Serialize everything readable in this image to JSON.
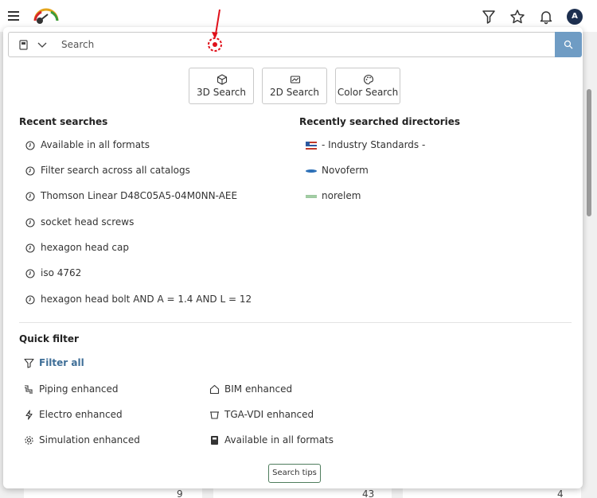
{
  "colors": {
    "accent_blue": "#6f9cc4",
    "link_blue": "#3e6e97",
    "tips_border": "#4f7d5d",
    "cursor_red": "#e0101a",
    "avatar_bg": "#1d2f4f"
  },
  "topbar": {
    "menu_icon": "hamburger-icon",
    "logo_icon": "gauge-logo-icon",
    "filter_icon": "funnel-icon",
    "favorites_icon": "star-icon",
    "notifications_icon": "bell-icon",
    "avatar_initial": "A"
  },
  "search": {
    "placeholder": "Search",
    "value": "",
    "category_icon": "catalog-icon",
    "dropdown_icon": "chevron-down-icon",
    "submit_icon": "search-icon"
  },
  "modes": [
    {
      "label": "3D Search",
      "icon": "cube-icon"
    },
    {
      "label": "2D Search",
      "icon": "drawing-icon"
    },
    {
      "label": "Color Search",
      "icon": "palette-icon"
    }
  ],
  "recent_searches": {
    "title": "Recent searches",
    "items": [
      "Available in all formats",
      "Filter search across all catalogs",
      "Thomson Linear D48C05A5-04M0NN-AEE",
      "socket head screws",
      "hexagon head cap",
      "iso 4762",
      "hexagon head bolt AND A = 1.4 AND L = 12"
    ]
  },
  "recent_directories": {
    "title": "Recently searched directories",
    "items": [
      {
        "label": "- Industry Standards -",
        "icon": "flag-grid-icon"
      },
      {
        "label": "Novoferm",
        "icon": "novoferm-logo-icon"
      },
      {
        "label": "norelem",
        "icon": "norelem-logo-icon"
      }
    ]
  },
  "quick_filter": {
    "title": "Quick filter",
    "filter_all": "Filter all",
    "items": [
      {
        "label": "Piping enhanced",
        "icon": "piping-icon"
      },
      {
        "label": "BIM enhanced",
        "icon": "house-icon"
      },
      {
        "label": "Electro enhanced",
        "icon": "lightning-icon"
      },
      {
        "label": "TGA-VDI enhanced",
        "icon": "hvac-icon"
      },
      {
        "label": "Simulation enhanced",
        "icon": "gear-icon"
      },
      {
        "label": "Available in all formats",
        "icon": "catalog-icon"
      }
    ]
  },
  "search_tips_label": "Search tips",
  "background_counts": [
    "9",
    "43",
    "4"
  ]
}
